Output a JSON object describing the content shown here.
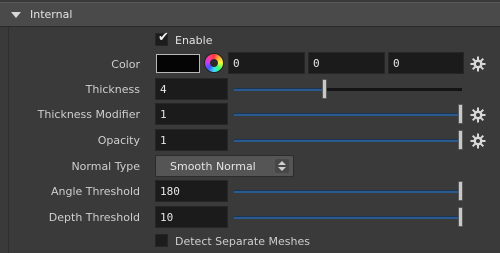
{
  "section": {
    "title": "Internal"
  },
  "enable": {
    "label": "Enable",
    "checked": true
  },
  "color": {
    "label": "Color",
    "swatch": "#050505",
    "r": "0",
    "g": "0",
    "b": "0"
  },
  "thickness": {
    "label": "Thickness",
    "value": "4",
    "fraction": 0.4
  },
  "thickness_modifier": {
    "label": "Thickness Modifier",
    "value": "1",
    "fraction": 1.0
  },
  "opacity": {
    "label": "Opacity",
    "value": "1",
    "fraction": 1.0
  },
  "normal_type": {
    "label": "Normal Type",
    "value": "Smooth Normal"
  },
  "angle_threshold": {
    "label": "Angle Threshold",
    "value": "180",
    "fraction": 1.0
  },
  "depth_threshold": {
    "label": "Depth Threshold",
    "value": "10",
    "fraction": 1.0
  },
  "detect_separate": {
    "label": "Detect Separate Meshes",
    "checked": false
  },
  "icons": {
    "collapse": "triangle-down-icon",
    "gear": "gear-icon",
    "color_wheel": "color-wheel-icon"
  }
}
